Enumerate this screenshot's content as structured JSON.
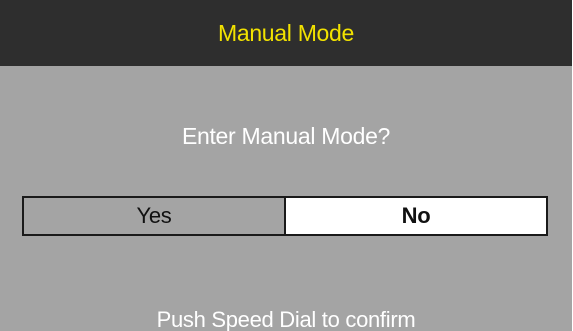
{
  "dialog": {
    "title": "Manual Mode",
    "prompt": "Enter Manual Mode?",
    "options": [
      {
        "label": "Yes",
        "selected": false
      },
      {
        "label": "No",
        "selected": true
      }
    ],
    "hint": "Push Speed Dial to confirm"
  },
  "colors": {
    "title_bar_bg": "#2e2e2e",
    "title_text": "#f2e200",
    "screen_bg": "#a4a4a4",
    "selected_bg": "#ffffff",
    "border": "#1a1a1a",
    "text_light": "#ffffff",
    "text_dark": "#111111"
  }
}
